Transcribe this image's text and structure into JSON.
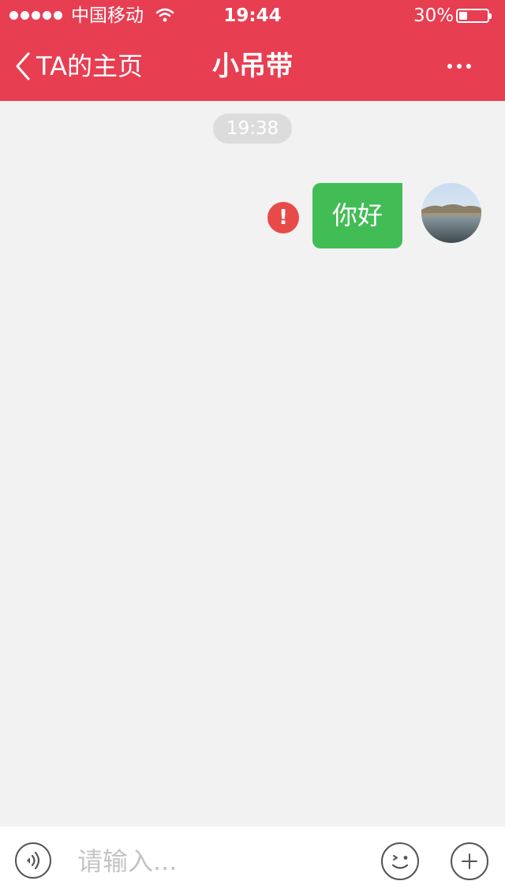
{
  "status_bar": {
    "carrier": "中国移动",
    "time": "19:44",
    "battery_percent": "30%",
    "battery_level": 0.3,
    "signal_bars": 5
  },
  "nav": {
    "back_label": "TA的主页",
    "title": "小吊带",
    "more_icon": "more-dots-icon"
  },
  "chat": {
    "timestamp": "19:38",
    "messages": [
      {
        "text": "你好",
        "direction": "outgoing",
        "status": "failed",
        "status_icon": "error-icon"
      }
    ]
  },
  "input_bar": {
    "placeholder": "请输入...",
    "value": "",
    "voice_icon": "voice-icon",
    "emoji_icon": "emoji-icon",
    "plus_icon": "plus-icon"
  },
  "colors": {
    "header_bg": "#e83e52",
    "bubble_bg": "#42bd56",
    "error_red": "#e84a4a",
    "chat_bg": "#f2f2f2"
  }
}
